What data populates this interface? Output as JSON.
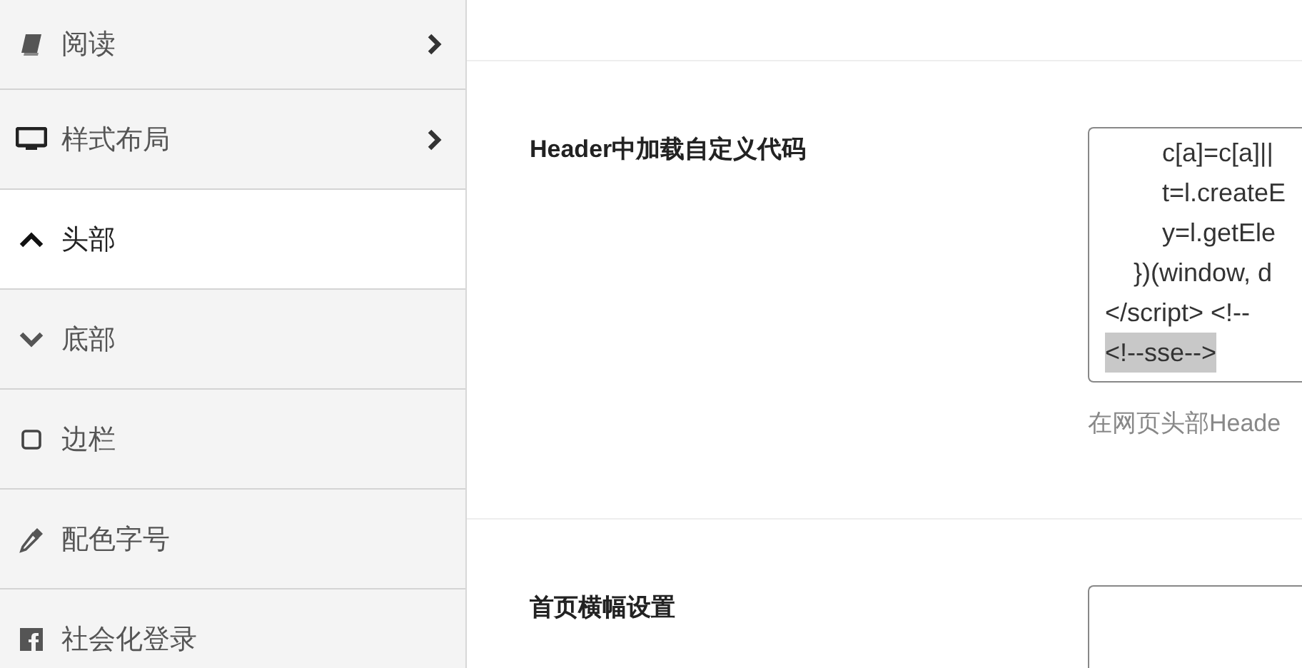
{
  "sidebar": {
    "items": [
      {
        "label": "阅读",
        "kind": "submenu",
        "selected": false
      },
      {
        "label": "样式布局",
        "kind": "submenu",
        "selected": false
      },
      {
        "label": "头部",
        "kind": "section",
        "expanded": true,
        "selected": true
      },
      {
        "label": "底部",
        "kind": "section",
        "expanded": false,
        "selected": false
      },
      {
        "label": "边栏",
        "kind": "link",
        "selected": false
      },
      {
        "label": "配色字号",
        "kind": "link",
        "selected": false
      },
      {
        "label": "社会化登录",
        "kind": "link",
        "selected": false
      }
    ]
  },
  "settings": [
    {
      "label": "Header中加载自定义代码",
      "code_lines": [
        {
          "text": "        c[a]=c[a]||",
          "selected": false
        },
        {
          "text": "        t=l.createE",
          "selected": false
        },
        {
          "text": "        y=l.getEle",
          "selected": false
        },
        {
          "text": "    })(window, d",
          "selected": false
        },
        {
          "text": "</script> <!--",
          "selected": false
        },
        {
          "text": "<!--sse-->",
          "selected": true
        }
      ],
      "hint": "在网页头部Heade"
    },
    {
      "label": "首页横幅设置"
    }
  ]
}
